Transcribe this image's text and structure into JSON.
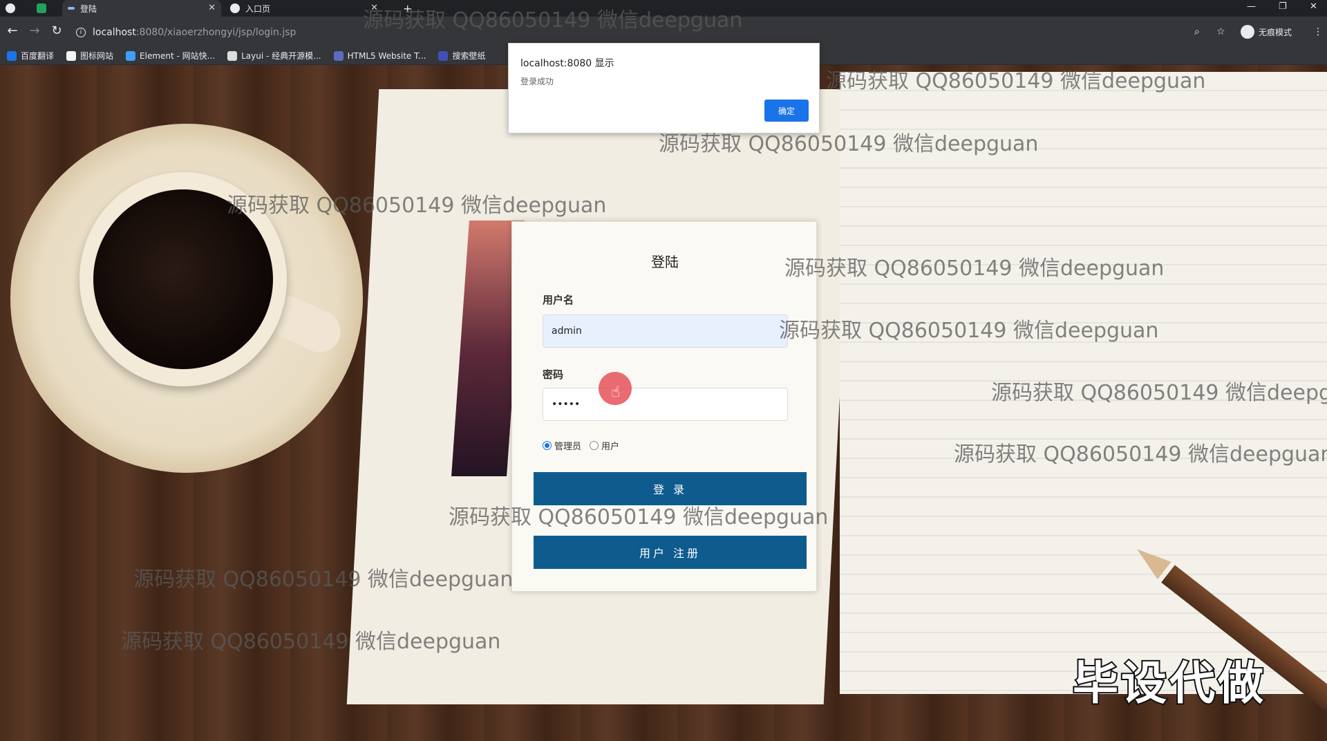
{
  "browser": {
    "tabs": [
      {
        "label": "登陆",
        "active": true
      },
      {
        "label": "入口页",
        "active": false
      }
    ],
    "new_tab_symbol": "+",
    "url_host": "localhost",
    "url_path": ":8080/xiaoerzhongyi/jsp/login.jsp",
    "profile_label": "无痕模式",
    "bookmarks": [
      {
        "label": "百度翻译",
        "color": "#1a73e8"
      },
      {
        "label": "图标网站",
        "color": "#f4f4f4"
      },
      {
        "label": "Element - 网站快...",
        "color": "#409eff"
      },
      {
        "label": "Layui - 经典开源模...",
        "color": "#dddddd"
      },
      {
        "label": "HTML5 Website T...",
        "color": "#5c6bc0"
      },
      {
        "label": "搜索壁纸",
        "color": "#3f51b5"
      }
    ]
  },
  "alert": {
    "title": "localhost:8080 显示",
    "message": "登录成功",
    "ok_label": "确定"
  },
  "login": {
    "title": "登陆",
    "username_label": "用户名",
    "username_value": "admin",
    "password_label": "密码",
    "password_value": "•••••",
    "role_admin": "管理员",
    "role_user": "用户",
    "selected_role": "管理员",
    "login_button": "登 录",
    "register_button": "用户 注册"
  },
  "watermark_text": "源码获取 QQ86050149 微信deepguan",
  "corner_mark": "毕设代做",
  "colors": {
    "primary_button": "#0e5b8e",
    "alert_button": "#1a73e8"
  }
}
